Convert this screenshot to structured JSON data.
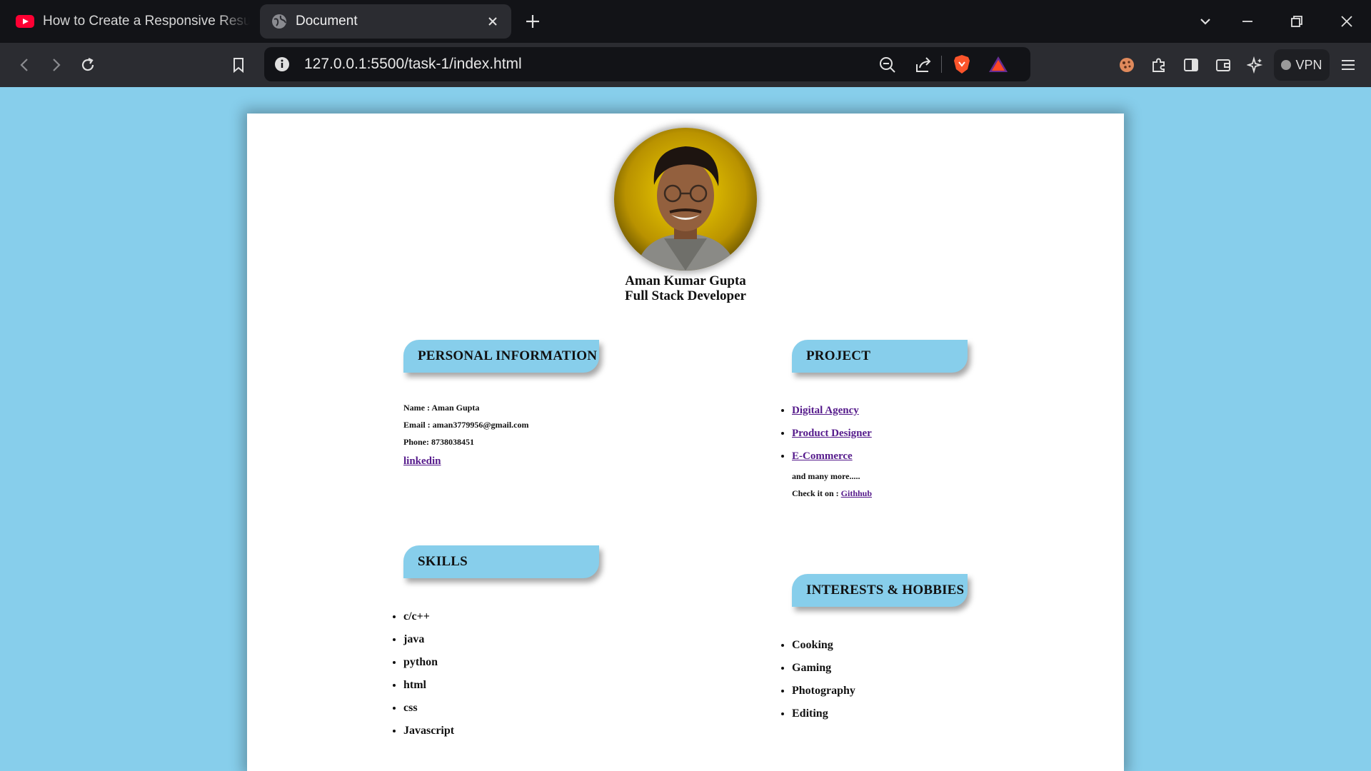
{
  "browser": {
    "tabs": [
      {
        "title": "How to Create a Responsive Resume"
      },
      {
        "title": "Document"
      }
    ],
    "url": "127.0.0.1:5500/task-1/index.html",
    "vpn_label": "VPN"
  },
  "resume": {
    "name": "Aman Kumar Gupta",
    "role": "Full Stack Developer",
    "personal": {
      "heading": "PERSONAL INFORMATION",
      "name_line": "Name : Aman Gupta",
      "email_line": "Email : aman3779956@gmail.com",
      "phone_line": "Phone: 8738038451",
      "link_label": "linkedin"
    },
    "project": {
      "heading": "PROJECT",
      "items": [
        "Digital Agency",
        "Product Designer",
        "E-Commerce"
      ],
      "more": "and many more.....",
      "check_prefix": "Check it on : ",
      "github_label": "Githhub"
    },
    "skills": {
      "heading": "SKILLS",
      "items": [
        "c/c++",
        "java",
        "python",
        "html",
        "css",
        "Javascript"
      ]
    },
    "interests": {
      "heading": "INTERESTS & HOBBIES",
      "items": [
        "Cooking",
        "Gaming",
        "Photography",
        "Editing"
      ]
    }
  },
  "colors": {
    "page_background": "#87ceeb",
    "section_header": "#87ceeb",
    "link": "#551a8b",
    "youtube_red": "#ff0033",
    "brave_orange": "#fb542b"
  }
}
